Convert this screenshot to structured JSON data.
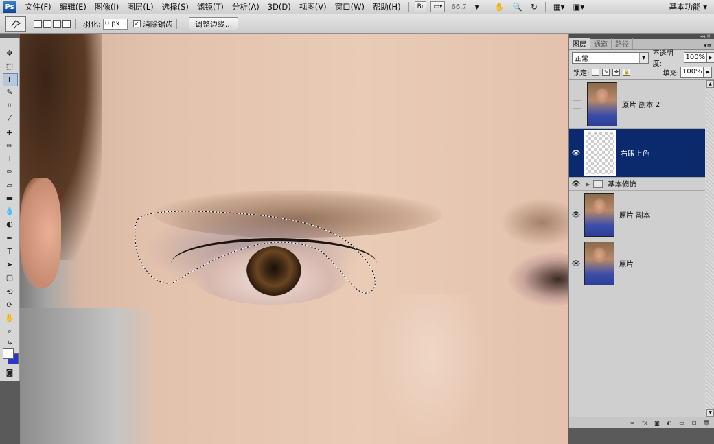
{
  "app": {
    "logo": "Ps"
  },
  "menu": [
    "文件(F)",
    "编辑(E)",
    "图像(I)",
    "图层(L)",
    "选择(S)",
    "滤镜(T)",
    "分析(A)",
    "3D(D)",
    "视图(V)",
    "窗口(W)",
    "帮助(H)"
  ],
  "appbar": {
    "bridge": "Br",
    "zoom": "66.7",
    "workspace": "基本功能"
  },
  "options": {
    "feather_label": "羽化:",
    "feather_value": "0 px",
    "antialias_label": "消除锯齿",
    "refine_button": "调整边缘..."
  },
  "panel": {
    "tabs": [
      "图层",
      "通道",
      "路径"
    ],
    "blend_mode": "正常",
    "opacity_label": "不透明度:",
    "opacity_value": "100%",
    "lock_label": "锁定:",
    "fill_label": "填充:",
    "fill_value": "100%",
    "layers": [
      {
        "name": "原片 副本 2",
        "visible": false,
        "selected": false,
        "kind": "photo"
      },
      {
        "name": "右眼上色",
        "visible": true,
        "selected": true,
        "kind": "transparent"
      },
      {
        "name": "基本修饰",
        "visible": true,
        "selected": false,
        "kind": "group"
      },
      {
        "name": "原片 副本",
        "visible": true,
        "selected": false,
        "kind": "photo"
      },
      {
        "name": "原片",
        "visible": true,
        "selected": false,
        "kind": "photo"
      }
    ]
  },
  "colors": {
    "selection_highlight": "#0b2a6e",
    "foreground": "#ffffff",
    "background": "#2b37c8"
  }
}
